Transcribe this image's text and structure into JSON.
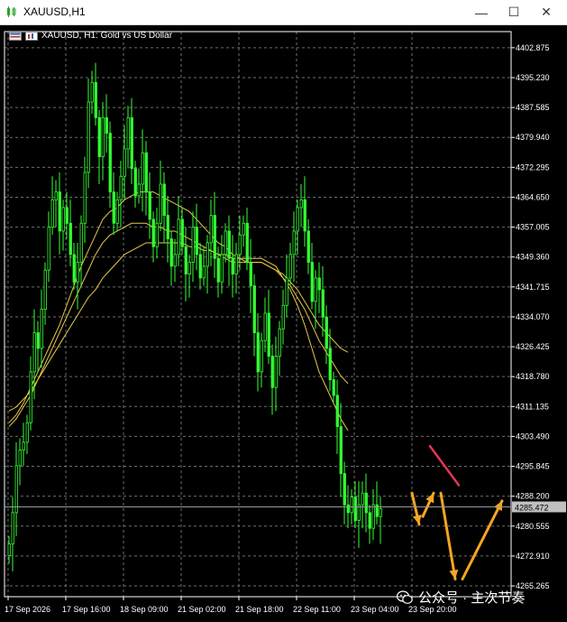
{
  "window": {
    "title": "XAUUSD,H1",
    "minimize_glyph": "—",
    "maximize_glyph": "☐",
    "close_glyph": "✕"
  },
  "chart_header": {
    "text": "XAUUSD, H1:  Gold vs US Dollar"
  },
  "watermark": {
    "text": "公众号 · 主次节奏"
  },
  "icons": [
    "chart-app-icon",
    "grid-icon",
    "chart-icon",
    "wechat-icon"
  ],
  "colors": {
    "background": "#000000",
    "grid": "#6e6e6e",
    "candle": "#33ff33",
    "ma": "#e6c84a",
    "arrow_orange": "#f5a623",
    "line_red": "#e8325a",
    "price_tag": "#c0c0c0"
  },
  "chart_data": {
    "type": "candlestick",
    "symbol": "XAUUSD",
    "timeframe": "H1",
    "y_ticks": [
      4402.875,
      4395.23,
      4387.585,
      4379.94,
      4372.295,
      4364.65,
      4357.005,
      4349.36,
      4341.715,
      4334.07,
      4326.425,
      4318.78,
      4311.135,
      4303.49,
      4295.845,
      4288.2,
      4280.555,
      4272.91,
      4265.265
    ],
    "y_tick_labels": [
      "4402.875",
      "4395.230",
      "4387.585",
      "4379.940",
      "4372.295",
      "4364.650",
      "4357.005",
      "4349.360",
      "4341.715",
      "4334.070",
      "4326.425",
      "4318.780",
      "4311.135",
      "4303.490",
      "4295.845",
      "4288.200",
      "4280.555",
      "4272.910",
      "4265.265"
    ],
    "ylim": [
      4262.5,
      4407.0
    ],
    "current_price": 4285.472,
    "current_price_label": "4285.472",
    "x_tick_labels": [
      "17 Sep 2026",
      "17 Sep 16:00",
      "18 Sep 09:00",
      "21 Sep 02:00",
      "21 Sep 18:00",
      "22 Sep 11:00",
      "23 Sep 04:00",
      "23 Sep 20:00"
    ],
    "x_tick_index": [
      0,
      16,
      32,
      48,
      64,
      80,
      96,
      112
    ],
    "closes": [
      4276,
      4284,
      4296,
      4300,
      4302,
      4307,
      4320,
      4330,
      4326,
      4336,
      4346,
      4357,
      4364,
      4366,
      4356,
      4362,
      4358,
      4350,
      4343,
      4348,
      4358,
      4371,
      4389,
      4394,
      4385,
      4375,
      4385,
      4381,
      4366,
      4358,
      4364,
      4370,
      4377,
      4385,
      4372,
      4365,
      4368,
      4376,
      4366,
      4359,
      4352,
      4358,
      4368,
      4360,
      4354,
      4347,
      4350,
      4359,
      4352,
      4345,
      4348,
      4357,
      4350,
      4344,
      4347,
      4353,
      4360,
      4349,
      4343,
      4350,
      4356,
      4349,
      4345,
      4350,
      4355,
      4358,
      4348,
      4342,
      4330,
      4320,
      4328,
      4335,
      4324,
      4316,
      4324,
      4331,
      4337,
      4344,
      4350,
      4356,
      4362,
      4364,
      4356,
      4348,
      4338,
      4344,
      4341,
      4334,
      4326,
      4318,
      4314,
      4306,
      4294,
      4286,
      4284,
      4288,
      4282,
      4286,
      4289,
      4284,
      4280,
      4286,
      4283,
      4285
    ],
    "ma_series": [
      {
        "values": [
          4307,
          4309,
          4312,
          4316,
          4320,
          4324,
          4328,
          4332,
          4337,
          4342,
          4347,
          4351,
          4355,
          4359,
          4361,
          4362,
          4364,
          4365,
          4366,
          4366,
          4366,
          4365,
          4364,
          4363,
          4362,
          4361,
          4359,
          4357,
          4355,
          4353,
          4352,
          4350,
          4349,
          4349,
          4349,
          4349,
          4348,
          4347,
          4344,
          4341,
          4337,
          4332,
          4326,
          4320,
          4316,
          4312,
          4308,
          4305
        ]
      },
      {
        "values": [
          4306,
          4308,
          4311,
          4314,
          4318,
          4322,
          4326,
          4330,
          4334,
          4338,
          4342,
          4346,
          4350,
          4353,
          4355,
          4356,
          4357,
          4358,
          4358,
          4358,
          4357,
          4357,
          4356,
          4356,
          4355,
          4354,
          4353,
          4352,
          4351,
          4350,
          4349,
          4348,
          4348,
          4348,
          4348,
          4348,
          4347,
          4346,
          4344,
          4342,
          4339,
          4336,
          4332,
          4328,
          4325,
          4322,
          4319,
          4317
        ]
      },
      {
        "values": [
          4310,
          4311,
          4313,
          4315,
          4318,
          4321,
          4324,
          4327,
          4330,
          4333,
          4336,
          4339,
          4341,
          4344,
          4346,
          4348,
          4350,
          4351,
          4352,
          4353,
          4353,
          4353,
          4353,
          4353,
          4353,
          4352,
          4352,
          4351,
          4351,
          4350,
          4350,
          4349,
          4349,
          4348,
          4348,
          4348,
          4347,
          4346,
          4345,
          4343,
          4341,
          4338,
          4335,
          4332,
          4330,
          4328,
          4326,
          4325
        ]
      }
    ],
    "annotations": [
      {
        "type": "polyline",
        "color_key": "line_red",
        "points": [
          [
            117,
            4301
          ],
          [
            121,
            4296
          ],
          [
            125,
            4291
          ]
        ]
      },
      {
        "type": "arrow",
        "color_key": "arrow_orange",
        "from": [
          112,
          4289
        ],
        "to": [
          114,
          4281
        ]
      },
      {
        "type": "arrow",
        "color_key": "arrow_orange",
        "from": [
          115,
          4283
        ],
        "to": [
          118,
          4289
        ]
      },
      {
        "type": "arrow",
        "color_key": "arrow_orange",
        "from": [
          120,
          4289
        ],
        "to": [
          124,
          4267
        ]
      },
      {
        "type": "arrow",
        "color_key": "arrow_orange",
        "from": [
          126,
          4267
        ],
        "to": [
          137,
          4287
        ]
      }
    ]
  }
}
